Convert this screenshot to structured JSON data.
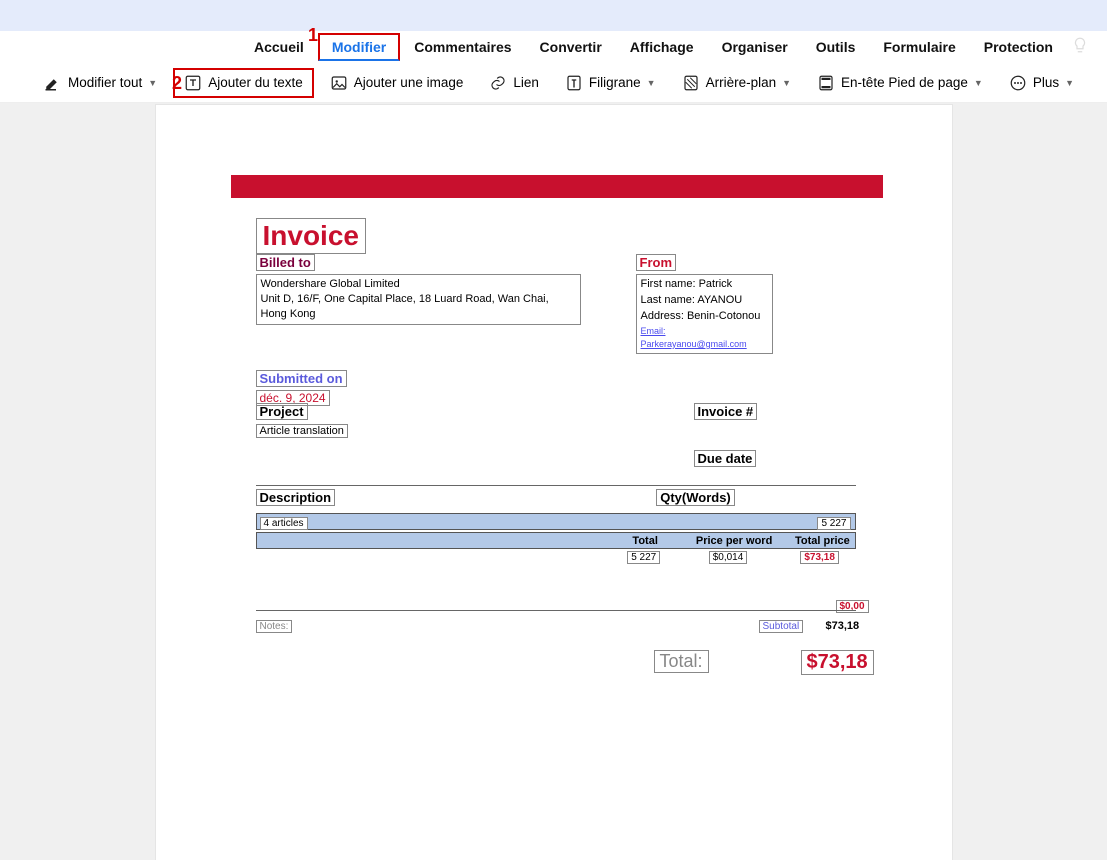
{
  "menubar": {
    "tabs": [
      "Accueil",
      "Modifier",
      "Commentaires",
      "Convertir",
      "Affichage",
      "Organiser",
      "Outils",
      "Formulaire",
      "Protection"
    ],
    "active_index": 1,
    "marker1": "1"
  },
  "toolbar": {
    "marker2": "2",
    "edit_all": "Modifier tout",
    "add_text": "Ajouter du texte",
    "add_image": "Ajouter une image",
    "link": "Lien",
    "watermark": "Filigrane",
    "background": "Arrière-plan",
    "headfoot": "En-tête Pied de page",
    "more": "Plus"
  },
  "doc": {
    "title": "Invoice",
    "billed_to_hdr": "Billed to",
    "billed_to_body": [
      "Wondershare Global Limited",
      "Unit D, 16/F, One Capital Place, 18 Luard Road, Wan Chai, Hong Kong"
    ],
    "from_hdr": "From",
    "from_body": {
      "fn": "First name: Patrick",
      "ln": "Last name: AYANOU",
      "addr": "Address: Benin-Cotonou",
      "email": "Email: Parkerayanou@gmail.com"
    },
    "submitted_hdr": "Submitted on",
    "submitted_date": "déc. 9, 2024",
    "project_hdr": "Project",
    "project_val": "Article translation",
    "invoice_no": "Invoice #",
    "due_date": "Due date",
    "desc_hdr": "Description",
    "qty_hdr": "Qty(Words)",
    "item_desc": "4 articles",
    "item_qty": "5 227",
    "sub_headers": {
      "total": "Total",
      "ppw": "Price per word",
      "tp": "Total price"
    },
    "totals_row": {
      "qty": "5 227",
      "ppw": "$0,014",
      "tp": "$73,18"
    },
    "zero": "$0,00",
    "notes": "Notes:",
    "subtotal_lbl": "Subtotal",
    "subtotal_val": "$73,18",
    "total_lbl": "Total:",
    "total_val": "$73,18"
  }
}
